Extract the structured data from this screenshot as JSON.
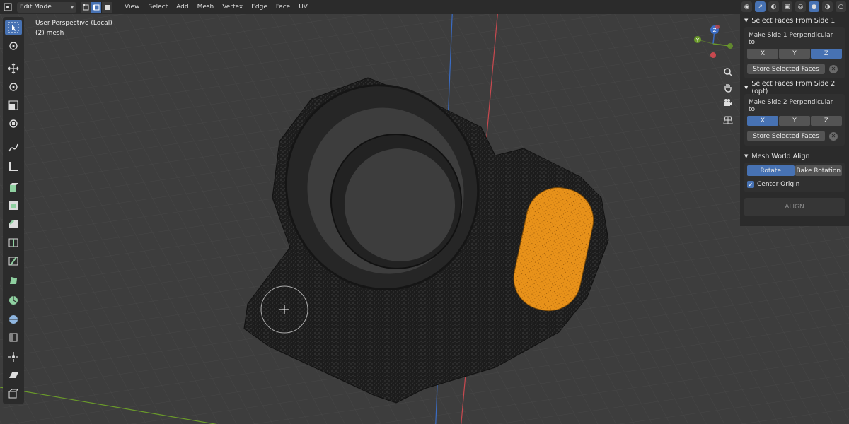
{
  "topbar": {
    "mode": "Edit Mode",
    "menus": [
      "View",
      "Select",
      "Add",
      "Mesh",
      "Vertex",
      "Edge",
      "Face",
      "UV"
    ]
  },
  "viewport": {
    "perspective": "User Perspective (Local)",
    "object": "(2) mesh"
  },
  "gizmo": {
    "x": "X",
    "y": "Y",
    "z": "Z"
  },
  "sidebar": {
    "side1": {
      "title": "Select Faces From Side 1",
      "label": "Make Side 1 Perpendicular to:",
      "axes": [
        "X",
        "Y",
        "Z"
      ],
      "selected_axis": "Z",
      "store_label": "Store Selected Faces"
    },
    "side2": {
      "title": "Select Faces From Side 2 (opt)",
      "label": "Make Side 2 Perpendicular to:",
      "axes": [
        "X",
        "Y",
        "Z"
      ],
      "selected_axis": "X",
      "store_label": "Store Selected Faces"
    },
    "align": {
      "title": "Mesh World Align",
      "rotate_label": "Rotate",
      "bake_label": "Bake Rotation",
      "center_origin_label": "Center Origin",
      "center_origin_checked": true,
      "align_label": "ALIGN"
    }
  },
  "colors": {
    "accent": "#4772b3",
    "selection": "#f29a1d",
    "mesh": "#1e1e1e",
    "x_axis": "#c8494f",
    "y_axis": "#6a9a2a",
    "z_axis": "#3a6cc4"
  }
}
